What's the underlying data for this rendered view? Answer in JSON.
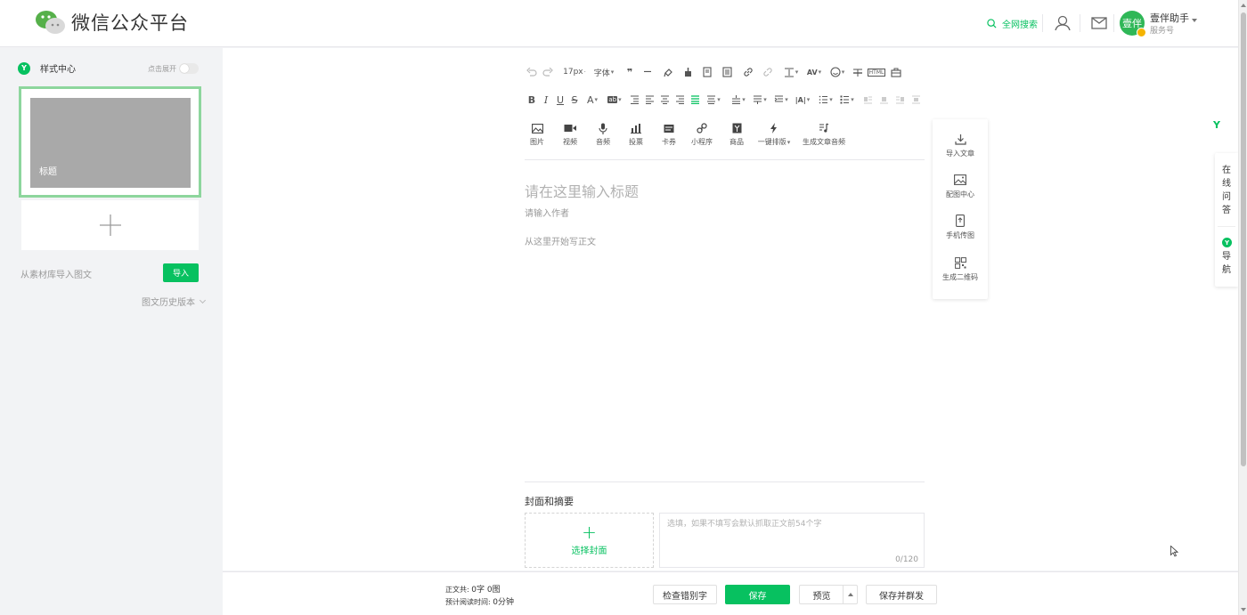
{
  "header": {
    "title": "微信公众平台",
    "search_label": "全网搜索",
    "account_name": "壹伴助手",
    "account_type": "服务号",
    "avatar_text": "壹伴"
  },
  "left": {
    "style_center": "样式中心",
    "style_badge": "Y",
    "expand_label": "点击展开",
    "article_title": "标题",
    "import_label": "从素材库导入图文",
    "import_button": "导入",
    "history_label": "图文历史版本"
  },
  "toolbar": {
    "font_size": "17px",
    "font_family": "字体",
    "media": [
      {
        "label": "图片",
        "icon": "image-icon"
      },
      {
        "label": "视频",
        "icon": "video-icon"
      },
      {
        "label": "音频",
        "icon": "audio-icon"
      },
      {
        "label": "投票",
        "icon": "poll-icon"
      },
      {
        "label": "卡券",
        "icon": "coupon-icon"
      },
      {
        "label": "小程序",
        "icon": "mini-program-icon"
      },
      {
        "label": "商品",
        "icon": "product-icon"
      },
      {
        "label": "一键排版",
        "icon": "lightning-icon"
      },
      {
        "label": "生成文章音频",
        "icon": "music-note-icon"
      }
    ]
  },
  "editor": {
    "title_placeholder": "请在这里输入标题",
    "author_placeholder": "请输入作者",
    "body_placeholder": "从这里开始写正文",
    "cover_title": "封面和摘要",
    "cover_select": "选择封面",
    "summary_placeholder": "选填，如果不填写会默认抓取正文前54个字",
    "summary_count": "0/120"
  },
  "right_tools": [
    {
      "label": "导入文章",
      "icon": "import-icon"
    },
    {
      "label": "配图中心",
      "icon": "picture-icon"
    },
    {
      "label": "手机传图",
      "icon": "phone-upload-icon"
    },
    {
      "label": "生成二维码",
      "icon": "qr-code-icon"
    }
  ],
  "side_float": {
    "qa": "在线问答",
    "nav": "导航"
  },
  "footer": {
    "text_total_label": "正文共:",
    "text_total_value": "0字 0图",
    "read_time_label": "预计阅读时间:",
    "read_time_value": "0分钟",
    "spell_check": "检查错别字",
    "save": "保存",
    "preview": "预览",
    "save_send": "保存并群发"
  },
  "colors": {
    "accent": "#07c160",
    "card_border": "#8dd69d",
    "thumb": "#a9a9a9"
  }
}
